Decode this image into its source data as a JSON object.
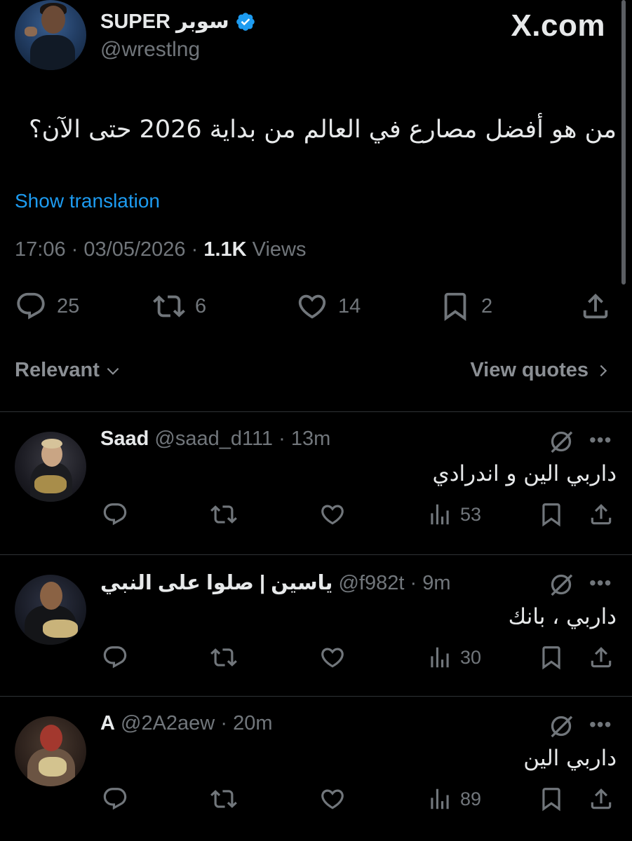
{
  "colors": {
    "background": "#000000",
    "text": "#e7e9ea",
    "muted": "#71767b",
    "link": "#1d9bf0",
    "divider": "#2f3336",
    "verified": "#1d9bf0"
  },
  "post": {
    "author_name": "SUPER سوبر",
    "author_handle": "@wrestlng",
    "verified": true,
    "brand": "X.com",
    "text": "من هو أفضل مصارع في العالم من بداية 2026 حتى الآن؟",
    "show_translation": "Show translation",
    "time": "17:06",
    "date": "03/05/2026",
    "views_count": "1.1K",
    "views_label": "Views",
    "sep": "·",
    "actions": {
      "replies": "25",
      "reposts": "6",
      "likes": "14",
      "bookmarks": "2"
    },
    "icons": [
      "reply-icon",
      "repost-icon",
      "like-icon",
      "bookmark-icon",
      "share-icon",
      "verified-badge-icon"
    ]
  },
  "filter": {
    "sort_label": "Relevant",
    "quotes_label": "View quotes"
  },
  "replies": [
    {
      "name": "Saad",
      "handle": "@saad_d111",
      "time": "13m",
      "text": "داربي الين و اندرادي",
      "views": "53"
    },
    {
      "name": "ياسين | صلوا على النبي",
      "handle": "@f982t",
      "time": "9m",
      "text": "داربي ، بانك",
      "views": "30"
    },
    {
      "name": "A",
      "handle": "@2A2aew",
      "time": "20m",
      "text": "داربي الين",
      "views": "89"
    }
  ],
  "reply_icons": [
    "grok-icon",
    "more-icon",
    "reply-icon",
    "repost-icon",
    "like-icon",
    "views-icon",
    "bookmark-icon",
    "share-icon"
  ],
  "more_glyph": "•••"
}
